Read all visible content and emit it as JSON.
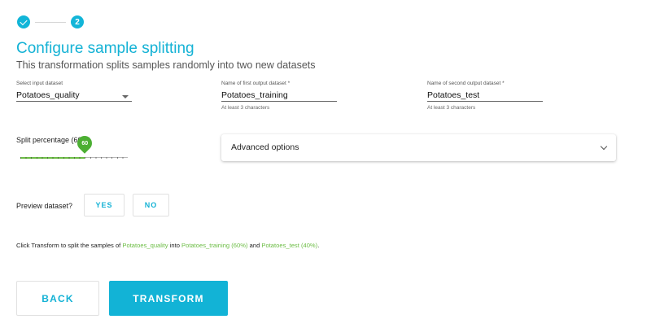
{
  "stepper": {
    "steps": [
      {
        "state": "complete",
        "icon": "check-icon"
      },
      {
        "label": "2",
        "state": "active"
      }
    ]
  },
  "title": "Configure sample splitting",
  "subtitle": "This transformation splits samples randomly into two new datasets",
  "fields": {
    "input_dataset": {
      "label": "Select input dataset",
      "value": "Potatoes_quality",
      "icon": "chevron-down-icon"
    },
    "first_output": {
      "label": "Name of first output dataset *",
      "value": "Potatoes_training",
      "hint": "At least 3 characters"
    },
    "second_output": {
      "label": "Name of second output dataset *",
      "value": "Potatoes_test",
      "hint": "At least 3 characters"
    }
  },
  "split": {
    "label": "Split percentage (60%)",
    "value": 60,
    "value_label": "60",
    "min": 0,
    "max": 100
  },
  "advanced": {
    "label": "Advanced options",
    "icon": "chevron-down-icon"
  },
  "preview": {
    "label": "Preview dataset?",
    "yes": "YES",
    "no": "NO"
  },
  "summary": {
    "prefix": "Click Transform to split the samples of ",
    "input": "Potatoes_quality",
    "mid1": " into ",
    "first": "Potatoes_training (60%)",
    "mid2": " and ",
    "second": "Potatoes_test (40%)",
    "suffix": "."
  },
  "buttons": {
    "back": "BACK",
    "transform": "TRANSFORM"
  },
  "colors": {
    "accent": "#14b2d5",
    "success": "#6cbd45"
  }
}
